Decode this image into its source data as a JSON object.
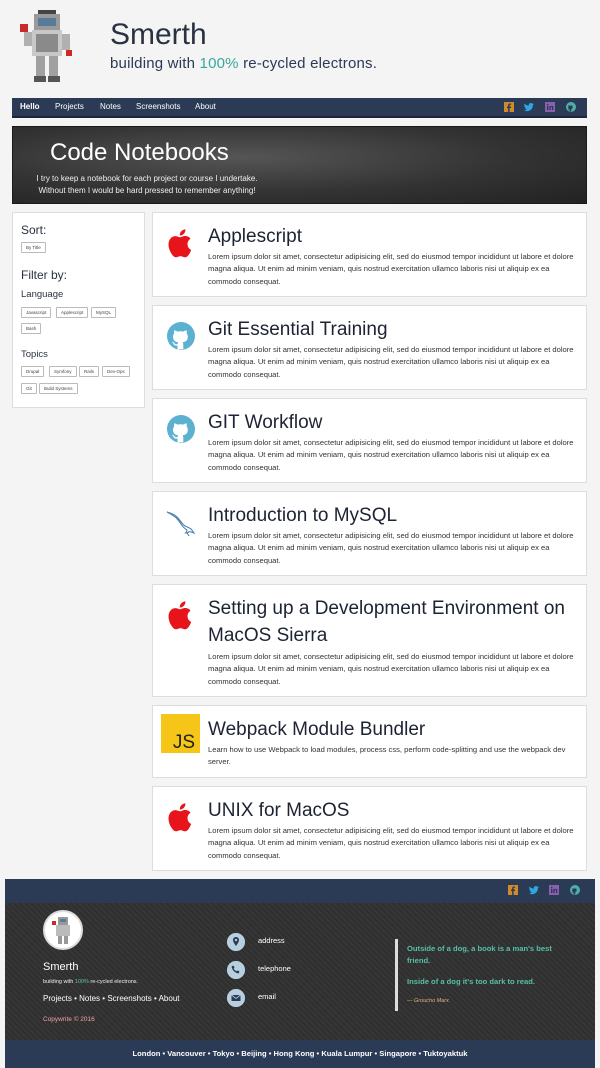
{
  "site": {
    "title": "Smerth",
    "tagline_pre": "building with ",
    "tagline_pct": "100%",
    "tagline_post": " re-cycled electrons."
  },
  "nav": {
    "items": [
      "Hello",
      "Projects",
      "Notes",
      "Screenshots",
      "About"
    ],
    "social": [
      "facebook-icon",
      "twitter-icon",
      "linkedin-icon",
      "github-icon"
    ]
  },
  "banner": {
    "title": "Code Notebooks",
    "line1": "I try to keep a notebook for each project or course I undertake.",
    "line2": "Without them I would be hard pressed to remember anything!"
  },
  "sidebar": {
    "sort_label": "Sort:",
    "sort_option": "By Title",
    "filter_label": "Filter by:",
    "language_label": "Language",
    "languages": [
      "Javascript",
      "Applescript",
      "MySQL",
      "Bash"
    ],
    "topics_label": "Topics",
    "topics": [
      "Drupal",
      "Symfony",
      "Rails",
      "Dev-Ops",
      "Git",
      "Build Systems"
    ]
  },
  "cards": [
    {
      "icon": "apple-icon",
      "title": "Applescript",
      "desc": "Lorem ipsum dolor sit amet, consectetur adipisicing elit, sed do eiusmod tempor incididunt ut labore et dolore magna aliqua. Ut enim ad minim veniam, quis nostrud exercitation ullamco laboris nisi ut aliquip ex ea commodo consequat."
    },
    {
      "icon": "github-icon",
      "title": "Git Essential Training",
      "desc": "Lorem ipsum dolor sit amet, consectetur adipisicing elit, sed do eiusmod tempor incididunt ut labore et dolore magna aliqua. Ut enim ad minim veniam, quis nostrud exercitation ullamco laboris nisi ut aliquip ex ea commodo consequat."
    },
    {
      "icon": "github-icon",
      "title": "GIT Workflow",
      "desc": "Lorem ipsum dolor sit amet, consectetur adipisicing elit, sed do eiusmod tempor incididunt ut labore et dolore magna aliqua. Ut enim ad minim veniam, quis nostrud exercitation ullamco laboris nisi ut aliquip ex ea commodo consequat."
    },
    {
      "icon": "mysql-dolphin-icon",
      "title": "Introduction to MySQL",
      "desc": "Lorem ipsum dolor sit amet, consectetur adipisicing elit, sed do eiusmod tempor incididunt ut labore et dolore magna aliqua. Ut enim ad minim veniam, quis nostrud exercitation ullamco laboris nisi ut aliquip ex ea commodo consequat."
    },
    {
      "icon": "apple-icon",
      "title": "Setting up a Development Environment on MacOS Sierra",
      "desc": "Lorem ipsum dolor sit amet, consectetur adipisicing elit, sed do eiusmod tempor incididunt ut labore et dolore magna aliqua. Ut enim ad minim veniam, quis nostrud exercitation ullamco laboris nisi ut aliquip ex ea commodo consequat."
    },
    {
      "icon": "js-icon",
      "icon_text": "JS",
      "title": "Webpack Module Bundler",
      "desc": "Learn how to use Webpack to load modules, process css, perform code-splitting and use the webpack dev server."
    },
    {
      "icon": "apple-icon",
      "title": "UNIX for MacOS",
      "desc": "Lorem ipsum dolor sit amet, consectetur adipisicing elit, sed do eiusmod tempor incididunt ut labore et dolore magna aliqua. Ut enim ad minim veniam, quis nostrud exercitation ullamco laboris nisi ut aliquip ex ea commodo consequat."
    }
  ],
  "footer": {
    "brand": "Smerth",
    "tagline_pre": "building with ",
    "tagline_pct": "100%",
    "tagline_post": " re-cycled electrons.",
    "links": [
      "Projects",
      "Notes",
      "Screenshots",
      "About"
    ],
    "copyright": "Copywrite © 2016",
    "contact": [
      {
        "icon": "location-icon",
        "label": "address"
      },
      {
        "icon": "phone-icon",
        "label": "telephone"
      },
      {
        "icon": "envelope-icon",
        "label": "email"
      }
    ],
    "quote1": "Outside of a dog, a book is a man's best friend.",
    "quote2": "Inside of a dog it's too dark to read.",
    "quote_author": "— Groucho Marx",
    "cities": [
      "London",
      "Vancouver",
      "Tokyo",
      "Beijing",
      "Hong Kong",
      "Kuala Lumpur",
      "Singapore",
      "Tuktoyaktuk"
    ]
  },
  "colors": {
    "nav_bg": "#2b3a55",
    "accent_teal": "#3aa79a",
    "apple_red": "#e8141c",
    "github_blue": "#5bb1cf",
    "js_yellow": "#f5c518",
    "facebook": "#d08a2c",
    "twitter": "#2ca7e0",
    "linkedin": "#8a5fb0",
    "github_social": "#4fb0a8"
  }
}
